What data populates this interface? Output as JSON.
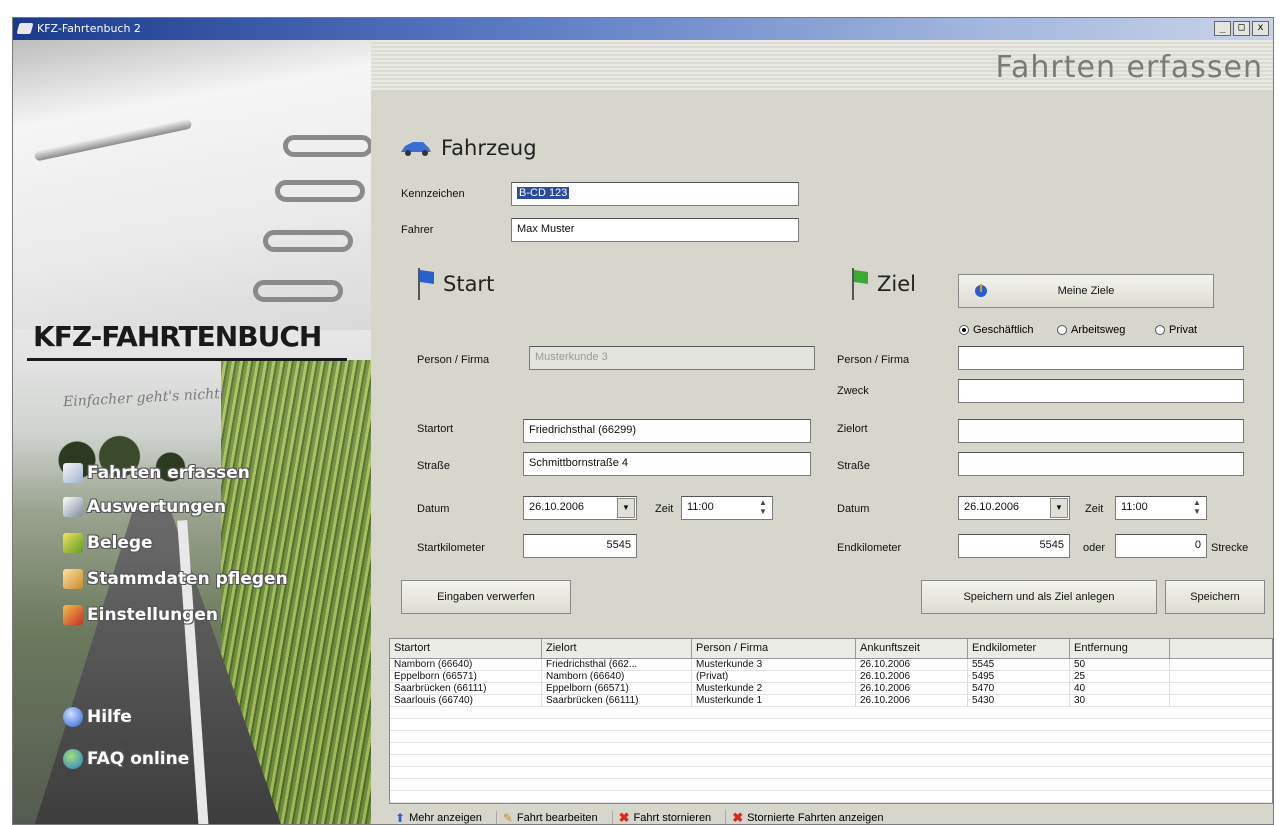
{
  "window": {
    "title": "KFZ-Fahrtenbuch 2",
    "controls": [
      "_",
      "□",
      "x"
    ]
  },
  "sidebar": {
    "logo": "KFZ-FAHRTENBUCH",
    "tagline": "Einfacher geht's nicht!",
    "items": [
      {
        "label": "Fahrten erfassen",
        "icon": "pencil-notepad-icon"
      },
      {
        "label": "Auswertungen",
        "icon": "printer-icon"
      },
      {
        "label": "Belege",
        "icon": "receipt-icon"
      },
      {
        "label": "Stammdaten pflegen",
        "icon": "folder-icon"
      },
      {
        "label": "Einstellungen",
        "icon": "settings-icon"
      },
      {
        "label": "Hilfe",
        "icon": "help-icon"
      },
      {
        "label": "FAQ online",
        "icon": "globe-icon"
      }
    ]
  },
  "page": {
    "title": "Fahrten erfassen"
  },
  "vehicle": {
    "title": "Fahrzeug",
    "kennzeichen_label": "Kennzeichen",
    "kennzeichen_value": "B-CD 123",
    "fahrer_label": "Fahrer",
    "fahrer_value": "Max Muster"
  },
  "start": {
    "title": "Start",
    "person_label": "Person / Firma",
    "person_value": "Musterkunde 3",
    "startort_label": "Startort",
    "startort_value": "Friedrichsthal (66299)",
    "strasse_label": "Straße",
    "strasse_value": "Schmittbornstraße 4",
    "datum_label": "Datum",
    "datum_value": "26.10.2006",
    "zeit_label": "Zeit",
    "zeit_value": "11:00",
    "km_label": "Startkilometer",
    "km_value": "5545"
  },
  "ziel": {
    "title": "Ziel",
    "meine_ziele": "Meine Ziele",
    "radios": [
      {
        "label": "Geschäftlich",
        "checked": true
      },
      {
        "label": "Arbeitsweg",
        "checked": false
      },
      {
        "label": "Privat",
        "checked": false
      }
    ],
    "person_label": "Person / Firma",
    "person_value": "",
    "zweck_label": "Zweck",
    "zweck_value": "",
    "zielort_label": "Zielort",
    "zielort_value": "",
    "strasse_label": "Straße",
    "strasse_value": "",
    "datum_label": "Datum",
    "datum_value": "26.10.2006",
    "zeit_label": "Zeit",
    "zeit_value": "11:00",
    "km_label": "Endkilometer",
    "km_value": "5545",
    "oder_label": "oder",
    "strecke_value": "0",
    "strecke_label": "Strecke"
  },
  "buttons": {
    "verwerfen": "Eingaben verwerfen",
    "speichern_ziel": "Speichern und als Ziel anlegen",
    "speichern": "Speichern"
  },
  "table": {
    "headers": [
      "Startort",
      "Zielort",
      "Person / Firma",
      "Ankunftszeit",
      "Endkilometer",
      "Entfernung"
    ],
    "rows": [
      [
        "Namborn (66640)",
        "Friedrichsthal (662...",
        "Musterkunde 3",
        "26.10.2006",
        "5545",
        "50"
      ],
      [
        "Eppelborn (66571)",
        "Namborn (66640)",
        "(Privat)",
        "26.10.2006",
        "5495",
        "25"
      ],
      [
        "Saarbrücken (66111)",
        "Eppelborn (66571)",
        "Musterkunde 2",
        "26.10.2006",
        "5470",
        "40"
      ],
      [
        "Saarlouis (66740)",
        "Saarbrücken (66111)",
        "Musterkunde 1",
        "26.10.2006",
        "5430",
        "30"
      ]
    ]
  },
  "footer": [
    {
      "label": "Mehr anzeigen",
      "icon": "arrow-up-icon"
    },
    {
      "label": "Fahrt bearbeiten",
      "icon": "edit-icon"
    },
    {
      "label": "Fahrt stornieren",
      "icon": "delete-x-icon"
    },
    {
      "label": "Stornierte Fahrten anzeigen",
      "icon": "delete-x-icon"
    }
  ],
  "colors": {
    "accent": "#2b4aa0",
    "flag_blue": "#2a5fd0",
    "flag_green": "#3aa832",
    "delete_red": "#d8281c"
  }
}
